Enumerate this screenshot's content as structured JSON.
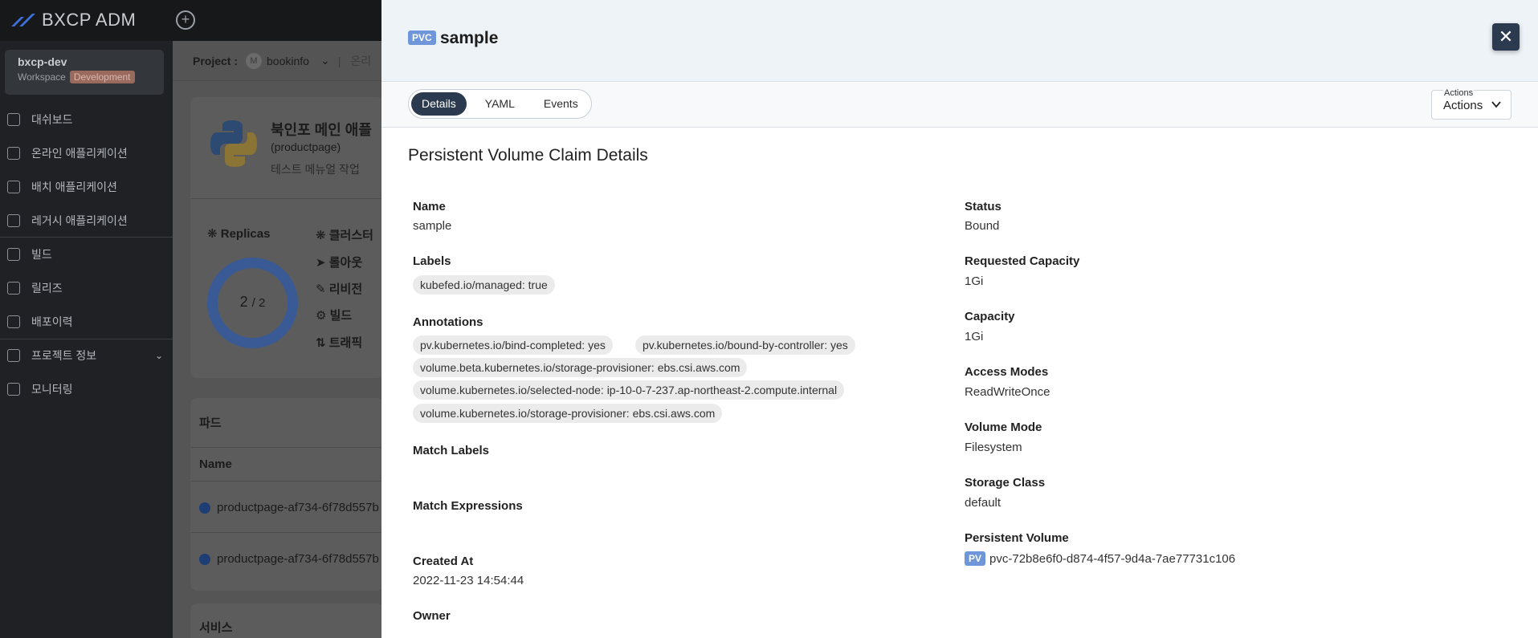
{
  "app": {
    "logo_text": "BXCP ADM"
  },
  "sidebar": {
    "workspace": {
      "name": "bxcp-dev",
      "label": "Workspace",
      "badge": "Development"
    },
    "items": [
      {
        "label": "대쉬보드",
        "icon": "dashboard-icon"
      },
      {
        "label": "온라인 애플리케이션",
        "icon": "online-app-icon"
      },
      {
        "label": "배치 애플리케이션",
        "icon": "batch-app-icon"
      },
      {
        "label": "레거시 애플리케이션",
        "icon": "legacy-app-icon"
      },
      {
        "label": "빌드",
        "icon": "build-icon"
      },
      {
        "label": "릴리즈",
        "icon": "release-icon"
      },
      {
        "label": "배포이력",
        "icon": "deploy-history-icon"
      },
      {
        "label": "프로젝트 정보",
        "icon": "project-info-icon"
      },
      {
        "label": "모니터링",
        "icon": "monitoring-icon"
      }
    ]
  },
  "background": {
    "project_label": "Project :",
    "project_avatar": "M",
    "project_name": "bookinfo",
    "project_extra": "온리",
    "app_title": "북인포 메인 애플",
    "app_subtitle": "(productpage)",
    "app_desc": "테스트 메뉴얼 작업",
    "replicas_label": "Replicas",
    "replicas_current": "2",
    "replicas_total": "/ 2",
    "side_items": [
      "클러스터",
      "롤아웃",
      "리비전",
      "빌드",
      "트래픽"
    ],
    "pods_title": "파드",
    "pods_col": "Name",
    "pods": [
      "productpage-af734-6f78d557b",
      "productpage-af734-6f78d557b"
    ],
    "services_title": "서비스"
  },
  "drawer": {
    "kind_badge": "PVC",
    "title": "sample",
    "tabs": [
      "Details",
      "YAML",
      "Events"
    ],
    "active_tab": "Details",
    "actions_legend": "Actions",
    "actions_value": "Actions",
    "section_title": "Persistent Volume Claim Details",
    "left": {
      "name_label": "Name",
      "name_value": "sample",
      "labels_label": "Labels",
      "labels": [
        "kubefed.io/managed: true"
      ],
      "annotations_label": "Annotations",
      "annotations": [
        "pv.kubernetes.io/bind-completed: yes",
        "pv.kubernetes.io/bound-by-controller: yes",
        "volume.beta.kubernetes.io/storage-provisioner: ebs.csi.aws.com",
        "volume.kubernetes.io/selected-node: ip-10-0-7-237.ap-northeast-2.compute.internal",
        "volume.kubernetes.io/storage-provisioner: ebs.csi.aws.com"
      ],
      "match_labels_label": "Match Labels",
      "match_expressions_label": "Match Expressions",
      "created_label": "Created At",
      "created_value": "2022-11-23 14:54:44",
      "owner_label": "Owner"
    },
    "right": {
      "status_label": "Status",
      "status_value": "Bound",
      "req_cap_label": "Requested Capacity",
      "req_cap_value": "1Gi",
      "cap_label": "Capacity",
      "cap_value": "1Gi",
      "access_label": "Access Modes",
      "access_value": "ReadWriteOnce",
      "volmode_label": "Volume Mode",
      "volmode_value": "Filesystem",
      "sc_label": "Storage Class",
      "sc_value": "default",
      "pv_label": "Persistent Volume",
      "pv_badge": "PV",
      "pv_value": "pvc-72b8e6f0-d874-4f57-9d4a-7ae77731c106"
    }
  },
  "colors": {
    "accent_dark": "#2b3a4e",
    "badge_blue": "#6e96d8",
    "sidebar_bg": "#1f2124",
    "header_bg": "#eef3f8"
  }
}
